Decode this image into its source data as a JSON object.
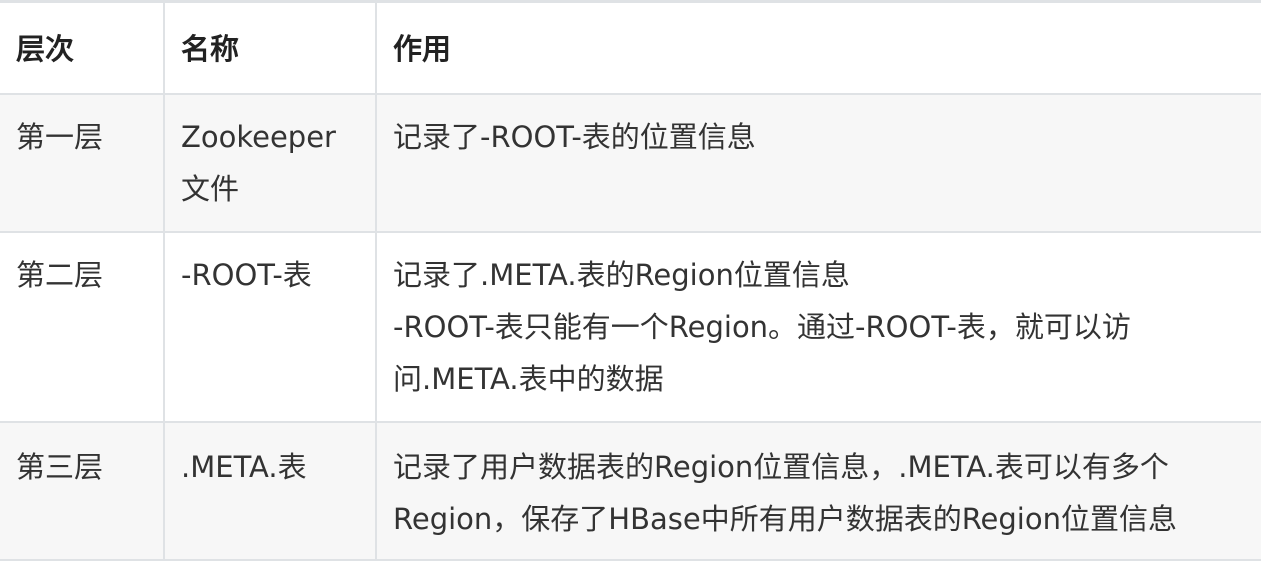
{
  "table": {
    "headers": [
      "层次",
      "名称",
      "作用"
    ],
    "rows": [
      {
        "level": "第一层",
        "name": "Zookeeper文件",
        "function": "记录了-ROOT-表的位置信息"
      },
      {
        "level": "第二层",
        "name": "-ROOT-表",
        "function_lines": [
          "记录了.META.表的Region位置信息",
          "-ROOT-表只能有一个Region。通过-ROOT-表，就可以访",
          "问.META.表中的数据"
        ]
      },
      {
        "level": "第三层",
        "name": ".META.表",
        "function_lines": [
          "记录了用户数据表的Region位置信息，.META.表可以有多个",
          "Region，保存了HBase中所有用户数据表的Region位置信息"
        ]
      }
    ]
  }
}
